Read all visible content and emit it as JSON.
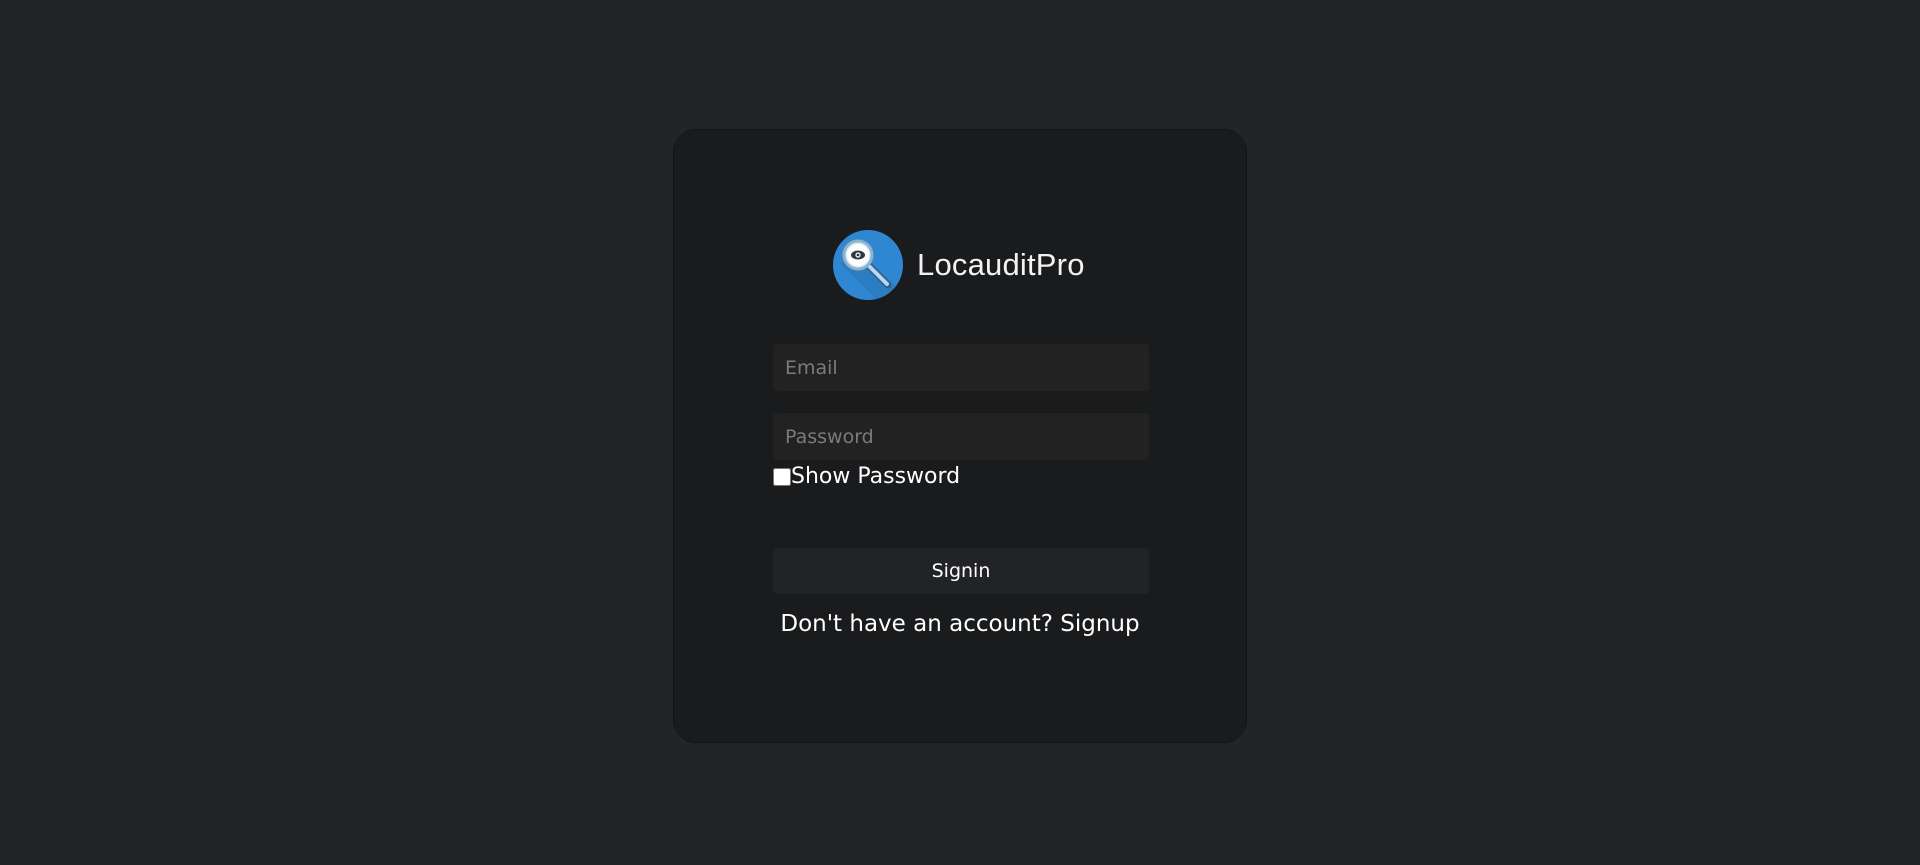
{
  "app": {
    "name": "LocauditPro",
    "logo_icon": "magnifier-eye-icon",
    "logo_color": "#2f87d1"
  },
  "form": {
    "email_placeholder": "Email",
    "email_value": "",
    "password_placeholder": "Password",
    "password_value": "",
    "show_password_label": "Show Password",
    "show_password_checked": false,
    "signin_label": "Signin"
  },
  "footer": {
    "prompt": "Don't have an account?",
    "signup_label": "Signup"
  },
  "colors": {
    "background": "#232427",
    "card": "#1a1b1d",
    "input": "#222223",
    "button": "#212327",
    "text": "#ffffff"
  }
}
